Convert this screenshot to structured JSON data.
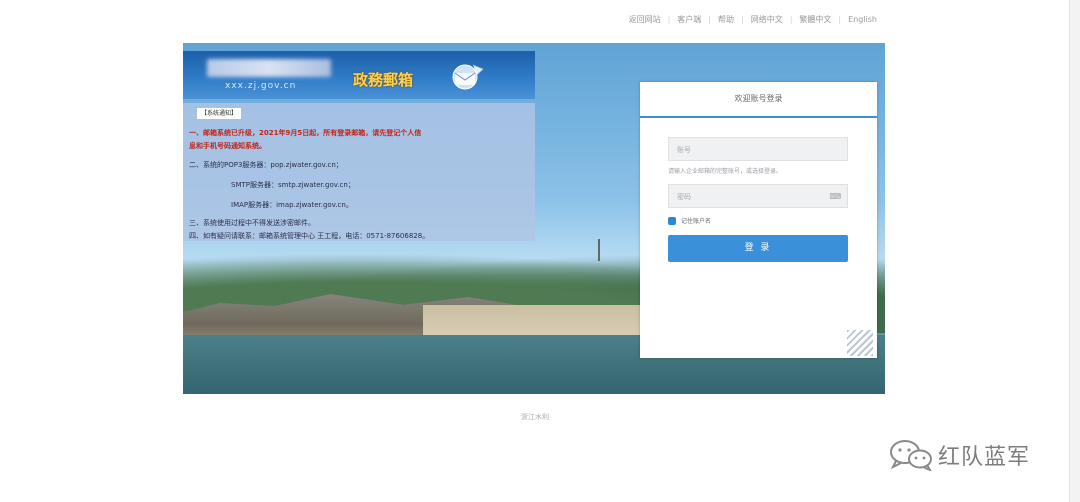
{
  "top_nav": [
    "返回网站",
    "客户端",
    "帮助",
    "网络中文",
    "繁體中文",
    "English"
  ],
  "banner": {
    "domain": "xxx.zj.gov.cn",
    "title": "政務郵箱"
  },
  "notice": {
    "title": "【系统通知】",
    "lines": [
      "一、邮箱系统已升级，2021年9月5日起，所有登录邮箱，请先登记个人信",
      "息和手机号码通知系统。",
      "二、系统的POP3服务器：pop.zjwater.gov.cn；",
      "SMTP服务器：smtp.zjwater.gov.cn；",
      "IMAP服务器：imap.zjwater.gov.cn。",
      "三、系统使用过程中不得发送涉密邮件。",
      "四、如有疑问请联系：邮箱系统管理中心 王工程，电话：0571-87606828。"
    ]
  },
  "login": {
    "header": "欢迎账号登录",
    "username_placeholder": "账号",
    "hint": "请输入企业邮箱的完整账号，或选择登录。",
    "password_placeholder": "密码",
    "remember_label": "记住账户名",
    "submit_label": "登 录"
  },
  "footer": "浙江水利",
  "watermark": "红队蓝军",
  "colors": {
    "accent": "#3a90d9",
    "banner_blue": "#1d5fa8",
    "notice_red": "#c0241a"
  }
}
